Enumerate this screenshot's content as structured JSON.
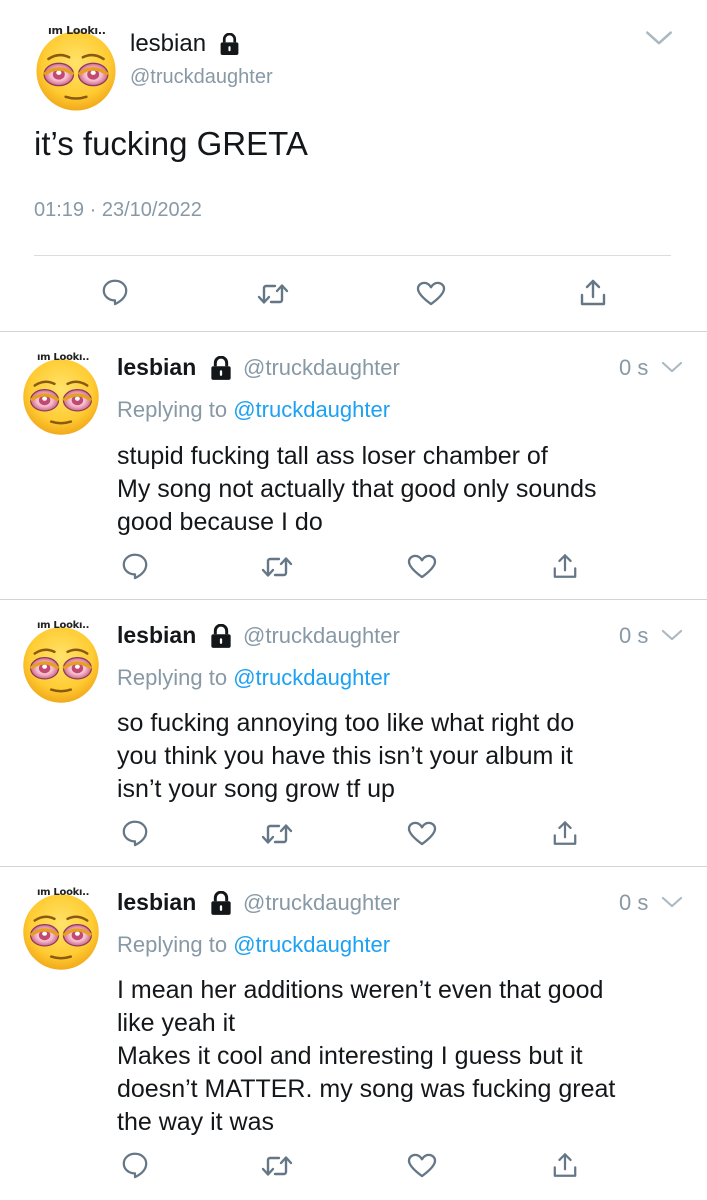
{
  "main_tweet": {
    "avatar_tag": "ım Lookı..",
    "display_name": "lesbian",
    "handle": "@truckdaughter",
    "text": "it’s fucking GRETA",
    "timestamp": "01:19 · 23/10/2022",
    "icons": {
      "locked": "lock-icon",
      "more": "chevron-down-icon",
      "reply": "reply-icon",
      "retweet": "retweet-icon",
      "like": "heart-icon",
      "share": "share-icon"
    }
  },
  "replies": [
    {
      "avatar_tag": "ım Lookı..",
      "display_name": "lesbian",
      "handle": "@truckdaughter",
      "time": "0 s",
      "replying_prefix": "Replying to",
      "replying_mention": "@truckdaughter",
      "text": "stupid fucking tall ass loser chamber of\nMy song not actually that good only sounds\ngood because I do"
    },
    {
      "avatar_tag": "ım Lookı..",
      "display_name": "lesbian",
      "handle": "@truckdaughter",
      "time": "0 s",
      "replying_prefix": "Replying to",
      "replying_mention": "@truckdaughter",
      "text": "so fucking annoying too like what right do\nyou think you have this isn’t your album it\nisn’t your song grow tf up"
    },
    {
      "avatar_tag": "ım Lookı..",
      "display_name": "lesbian",
      "handle": "@truckdaughter",
      "time": "0 s",
      "replying_prefix": "Replying to",
      "replying_mention": "@truckdaughter",
      "text": "I mean her additions weren’t even that good\nlike yeah it\nMakes it cool and interesting I guess but it\ndoesn’t MATTER. my song was fucking great\nthe way it was"
    }
  ],
  "colors": {
    "text": "#14171a",
    "muted": "#8899a6",
    "link": "#1da1f2",
    "divider": "#cfd5da",
    "icon": "#657786"
  }
}
